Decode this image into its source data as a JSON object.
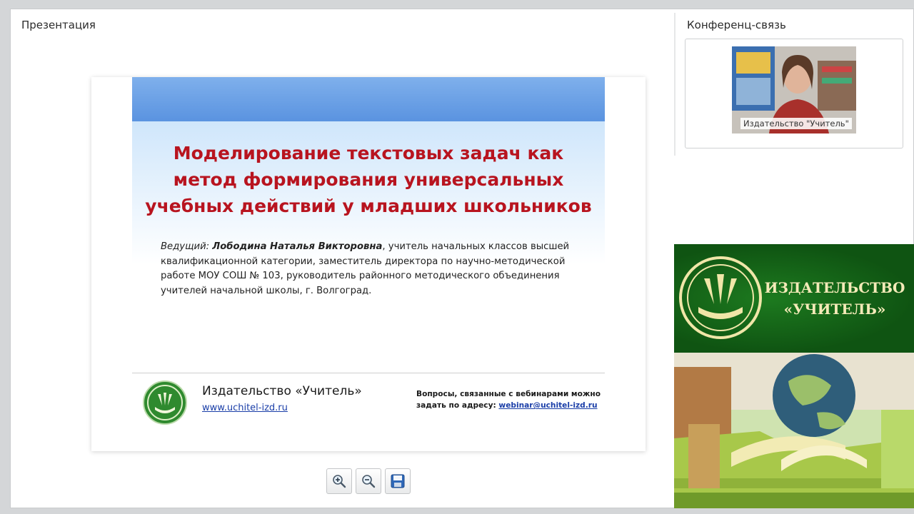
{
  "panels": {
    "presentation_title": "Презентация",
    "conference_title": "Конференц-связь"
  },
  "slide": {
    "heading_lines": [
      "Моделирование текстовых задач как",
      "метод формирования универсальных",
      "учебных действий у младших школьников"
    ],
    "presenter_prefix": "Ведущий: ",
    "presenter_name": "Лободина Наталья Викторовна",
    "presenter_desc": ", учитель начальных классов высшей квалификационной категории, заместитель директора по научно-методической работе МОУ СОШ № 103, руководитель районного методического объединения учителей начальной школы, г. Волгоград.",
    "publisher_name": "Издательство «Учитель»",
    "publisher_url": "www.uchitel-izd.ru",
    "questions_text": "Вопросы, связанные с вебинарами можно задать по адресу: ",
    "questions_email": "webinar@uchitel-izd.ru"
  },
  "toolbar": {
    "zoom_in_icon": "zoom-in-icon",
    "zoom_out_icon": "zoom-out-icon",
    "save_icon": "save-icon"
  },
  "video": {
    "label": "Издательство \"Учитель\""
  },
  "banner": {
    "line1": "ИЗДАТЕЛЬСТВО",
    "line2": "«УЧИТЕЛЬ»"
  },
  "colors": {
    "heading_red": "#b8141f",
    "banner_green": "#0f5412",
    "link_blue": "#1a3ea8"
  }
}
